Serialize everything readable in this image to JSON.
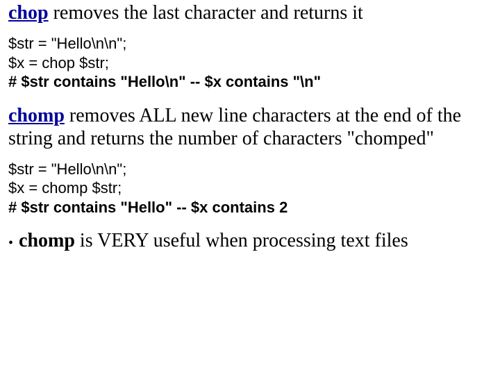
{
  "section1": {
    "keyword": "chop",
    "desc_rest": " removes the last character and returns it"
  },
  "code1": {
    "l1": "$str = \"Hello\\n\\n\";",
    "l2": "$x = chop $str;",
    "l3": "# $str contains \"Hello\\n\" --  $x contains \"\\n\""
  },
  "section2": {
    "keyword": "chomp",
    "desc_rest": " removes ALL new line characters at the end of the string and returns the number of characters \"chomped\""
  },
  "code2": {
    "l1": "$str = \"Hello\\n\\n\";",
    "l2": "$x = chomp $str;",
    "l3": "# $str contains \"Hello\" --  $x contains 2"
  },
  "bullet": {
    "dot": "•",
    "keyword": "chomp",
    "rest": " is VERY useful when processing text files"
  }
}
